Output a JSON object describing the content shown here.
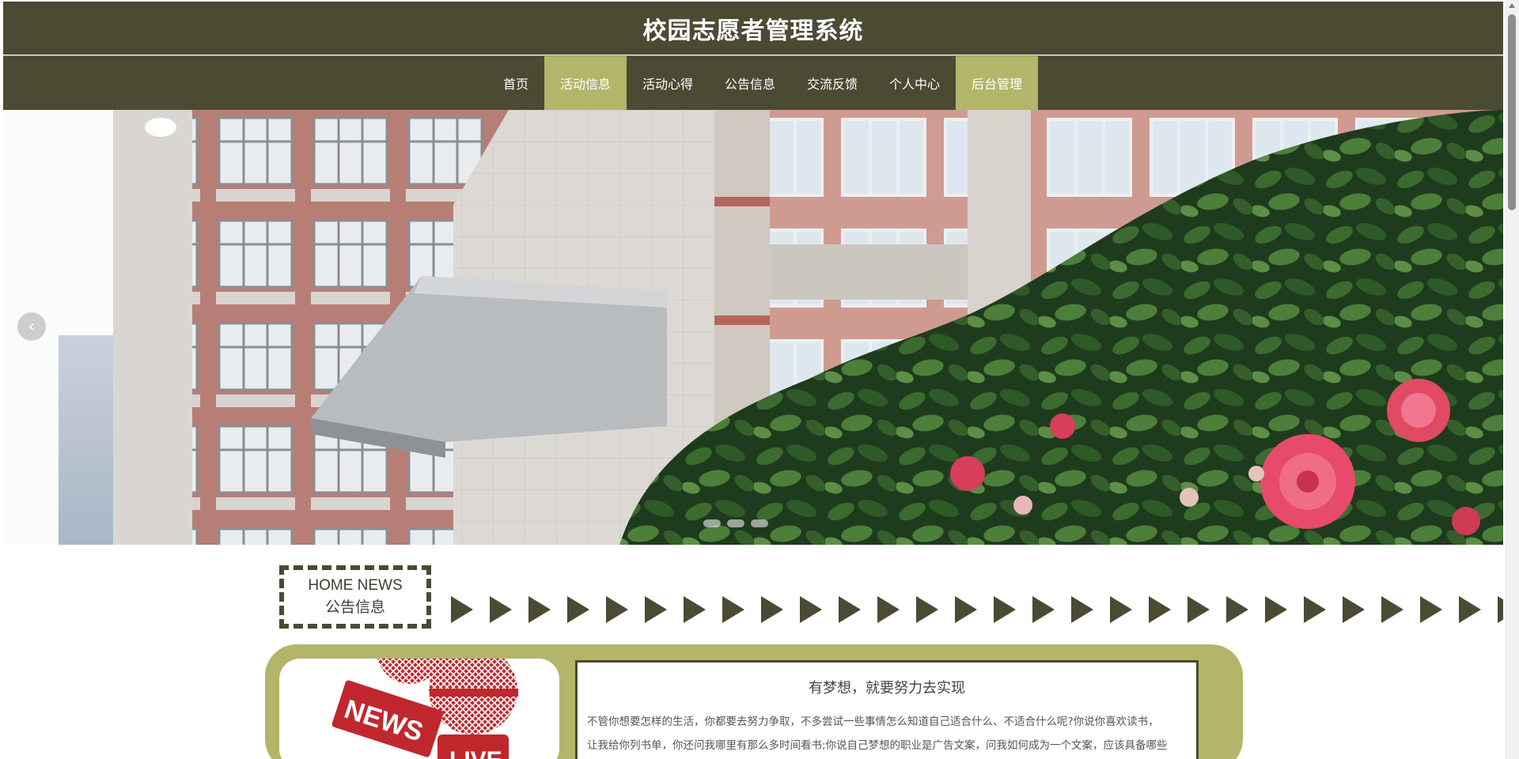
{
  "header": {
    "title": "校园志愿者管理系统"
  },
  "nav": {
    "items": [
      {
        "label": "首页",
        "active": false
      },
      {
        "label": "活动信息",
        "active": true
      },
      {
        "label": "活动心得",
        "active": false
      },
      {
        "label": "公告信息",
        "active": false
      },
      {
        "label": "交流反馈",
        "active": false
      },
      {
        "label": "个人中心",
        "active": false
      },
      {
        "label": "后台管理",
        "active": true
      }
    ]
  },
  "banner": {
    "prev_icon": "chevron-left-icon",
    "dot_count": 3
  },
  "news_section": {
    "label_en": "HOME NEWS",
    "label_cn": "公告信息",
    "arrow_icon": "play-triangle-icon"
  },
  "news": {
    "title": "有梦想，就要努力去实现",
    "line1": "不管你想要怎样的生活，你都要去努力争取，不多尝试一些事情怎么知道自己适合什么、不适合什么呢?你说你喜欢读书，",
    "line2": "让我给你列书单，你还问我哪里有那么多时间看书;你说自己梦想的职业是广告文案，问我如何成为一个文案，应该具备哪些",
    "image_badge_1": "NEWS",
    "image_badge_2": "LIVE"
  },
  "colors": {
    "header_bg": "#4b4a33",
    "accent": "#b2b56a",
    "news_red": "#c0282d"
  }
}
